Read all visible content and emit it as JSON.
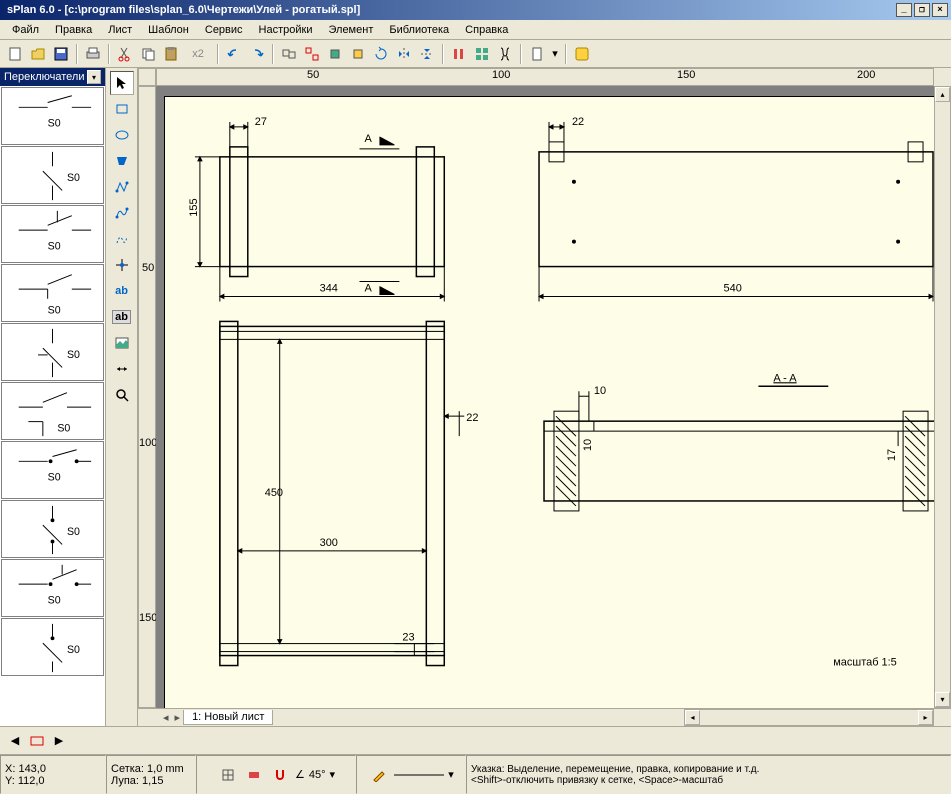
{
  "window": {
    "title": "sPlan 6.0 - [c:\\program files\\splan_6.0\\Чертежи\\Улей - рогатый.spl]"
  },
  "menu": [
    "Файл",
    "Правка",
    "Лист",
    "Шаблон",
    "Сервис",
    "Настройки",
    "Элемент",
    "Библиотека",
    "Справка"
  ],
  "library_header": "Переключатели",
  "ruler": {
    "h": [
      "50",
      "100",
      "150",
      "200"
    ],
    "v": [
      "50",
      "100",
      "150"
    ]
  },
  "tab": {
    "name": "1: Новый лист"
  },
  "status": {
    "pos": {
      "x": "X: 143,0",
      "y": "Y: 112,0"
    },
    "grid": "Сетка: 1,0 mm",
    "zoom": "Лупа: 1,15",
    "angle": "45°",
    "hint": "Указка: Выделение, перемещение, правка, копирование и т.д.\n<Shift>-отключить привязку к сетке, <Space>-масштаб"
  },
  "drawing": {
    "dims": {
      "d27": "27",
      "d155": "155",
      "d344": "344",
      "d22a": "22",
      "d540": "540",
      "d22b": "22",
      "d450": "450",
      "d300": "300",
      "d23": "23",
      "d10": "10",
      "d10v": "10",
      "d17": "17"
    },
    "labels": {
      "A1": "A",
      "A2": "A",
      "section": "A - A",
      "scale": "масштаб  1:5"
    }
  },
  "lib_label": "S0",
  "x2": "x2"
}
